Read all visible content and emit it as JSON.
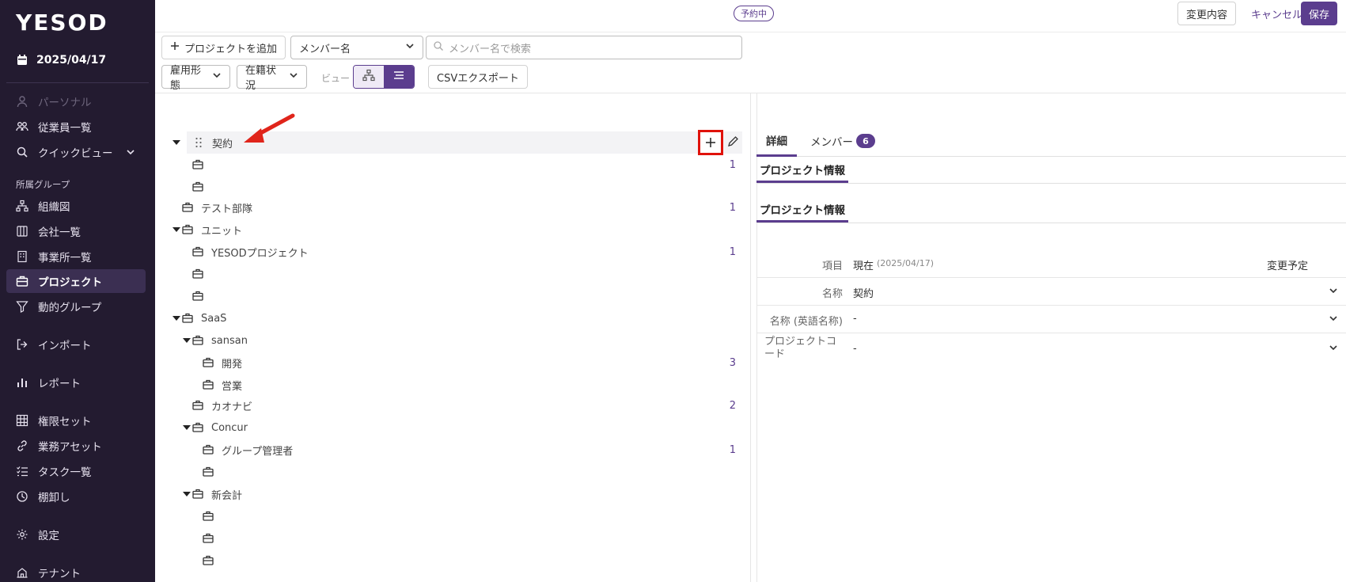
{
  "sidebar": {
    "logo": "YESOD",
    "date": "2025/04/17",
    "items": [
      {
        "label": "パーソナル",
        "icon": "person-icon"
      },
      {
        "label": "従業員一覧",
        "icon": "people-icon"
      },
      {
        "label": "クイックビュー",
        "icon": "search-icon"
      },
      {
        "label": "組織図",
        "icon": "org-chart-icon"
      },
      {
        "label": "会社一覧",
        "icon": "company-icon"
      },
      {
        "label": "事業所一覧",
        "icon": "building-icon"
      },
      {
        "label": "プロジェクト",
        "icon": "briefcase-icon"
      },
      {
        "label": "動的グループ",
        "icon": "filter-icon"
      },
      {
        "label": "インポート",
        "icon": "import-icon"
      },
      {
        "label": "レポート",
        "icon": "bar-chart-icon"
      },
      {
        "label": "権限セット",
        "icon": "grid-icon"
      },
      {
        "label": "業務アセット",
        "icon": "link-icon"
      },
      {
        "label": "タスク一覧",
        "icon": "checklist-icon"
      },
      {
        "label": "棚卸し",
        "icon": "inventory-icon"
      },
      {
        "label": "設定",
        "icon": "gear-icon"
      },
      {
        "label": "テナント",
        "icon": "tenant-icon"
      }
    ],
    "section_group": "所属グループ"
  },
  "topbar": {
    "status_badge": "予約中",
    "changes_label": "変更内容",
    "cancel_label": "キャンセル",
    "save_label": "保存"
  },
  "toolbar": {
    "add_project": "プロジェクトを追加",
    "member_select": "メンバー名",
    "search_placeholder": "メンバー名で検索",
    "employment_type": "雇用形態",
    "enrollment_status": "在籍状況",
    "view_label": "ビュー",
    "csv_export": "CSVエクスポート"
  },
  "tree": {
    "rows": [
      {
        "label": "契約",
        "count": ""
      },
      {
        "label": "",
        "count": "1"
      },
      {
        "label": "",
        "count": ""
      },
      {
        "label": "テスト部隊",
        "count": "1"
      },
      {
        "label": "ユニット",
        "count": ""
      },
      {
        "label": "YESODプロジェクト",
        "count": "1"
      },
      {
        "label": "",
        "count": ""
      },
      {
        "label": "",
        "count": ""
      },
      {
        "label": "SaaS",
        "count": ""
      },
      {
        "label": "sansan",
        "count": ""
      },
      {
        "label": "開発",
        "count": "3"
      },
      {
        "label": "営業",
        "count": ""
      },
      {
        "label": "カオナビ",
        "count": "2"
      },
      {
        "label": "Concur",
        "count": ""
      },
      {
        "label": "グループ管理者",
        "count": "1"
      },
      {
        "label": "",
        "count": ""
      },
      {
        "label": "新会計",
        "count": ""
      },
      {
        "label": "",
        "count": ""
      },
      {
        "label": "",
        "count": ""
      },
      {
        "label": "",
        "count": ""
      }
    ]
  },
  "detail": {
    "tab_details": "詳細",
    "tab_members": "メンバー",
    "members_count": "6",
    "subtab1": "プロジェクト情報",
    "subtab2": "プロジェクト情報",
    "head_item": "項目",
    "head_current": "現在",
    "head_current_date": "(2025/04/17)",
    "head_planned": "変更予定",
    "fields": [
      {
        "key": "名称",
        "value": "契約"
      },
      {
        "key": "名称 (英語名称)",
        "value": "-"
      },
      {
        "key": "プロジェクトコード",
        "value": "-"
      }
    ]
  },
  "colors": {
    "sidebar_bg": "#231b30",
    "accent": "#5b3d8e",
    "highlight": "#e0120b"
  }
}
